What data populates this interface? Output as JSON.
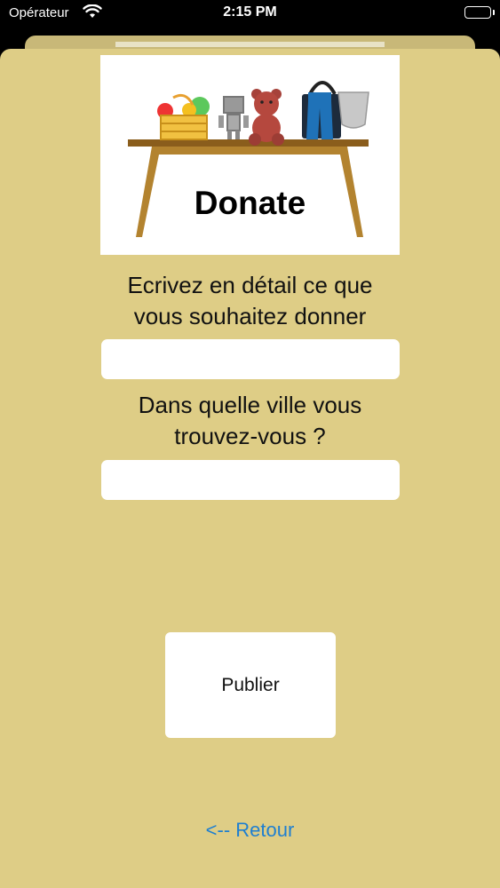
{
  "status_bar": {
    "carrier": "Opérateur",
    "time": "2:15 PM"
  },
  "hero": {
    "title": "Donate"
  },
  "form": {
    "description_label": "Ecrivez en détail ce que vous souhaitez donner",
    "description_value": "",
    "city_label": "Dans quelle ville vous trouvez-vous ?",
    "city_value": ""
  },
  "actions": {
    "publish_label": "Publier",
    "back_label": "<-- Retour"
  },
  "colors": {
    "background": "#decd86",
    "link": "#1f7fd0"
  }
}
